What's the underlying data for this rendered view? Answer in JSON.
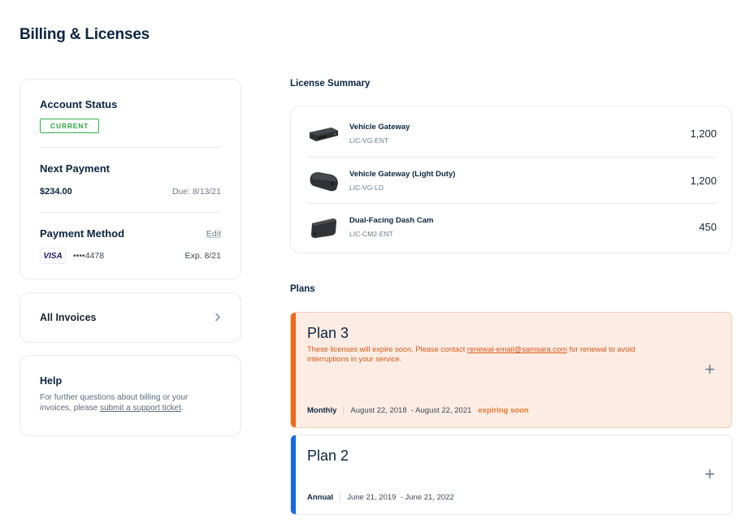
{
  "page": {
    "title": "Billing & Licenses"
  },
  "account": {
    "status_title": "Account Status",
    "status_badge": "CURRENT",
    "next_payment_title": "Next Payment",
    "next_payment_amount": "$234.00",
    "next_payment_due": "Due: 8/13/21",
    "payment_method_title": "Payment Method",
    "edit_label": "Edit",
    "card_brand": "VISA",
    "card_number": "••••4478",
    "card_expiry": "Exp. 8/21"
  },
  "invoices": {
    "label": "All Invoices",
    "icon": "chevron-right-icon"
  },
  "help": {
    "title": "Help",
    "text_before": "For further questions about billing or your invoices, please ",
    "link_text": "submit a support ticket",
    "text_after": "."
  },
  "license_summary": {
    "heading": "License Summary",
    "items": [
      {
        "name": "Vehicle Gateway",
        "sku": "LIC-VG-ENT",
        "count": "1,200",
        "icon": "vehicle-gateway-device"
      },
      {
        "name": "Vehicle Gateway (Light Duty)",
        "sku": "LIC-VG-LD",
        "count": "1,200",
        "icon": "vehicle-gateway-light-duty-device"
      },
      {
        "name": "Dual-Facing Dash Cam",
        "sku": "LIC-CM2-ENT",
        "count": "450",
        "icon": "dash-cam-device"
      }
    ]
  },
  "plans": {
    "heading": "Plans",
    "items": [
      {
        "name": "Plan 3",
        "warning_before": "These licenses will expire soon. Please contact ",
        "warning_link": "renewal-email@samsara.com",
        "warning_after": " for renewal to avoid interruptions in your service.",
        "type": "Monthly",
        "start": "August 22, 2018",
        "end": "- August 22, 2021",
        "status": "expiring soon",
        "accent": "#ed6a1c"
      },
      {
        "name": "Plan 2",
        "type": "Annual",
        "start": "June 21, 2019",
        "end": "- June 21, 2022",
        "accent": "#1769e0"
      }
    ],
    "expand_icon": "+"
  },
  "colors": {
    "current_badge": "#2aa63e",
    "warning": "#d65a17",
    "expiring_bg": "#fdece4"
  }
}
